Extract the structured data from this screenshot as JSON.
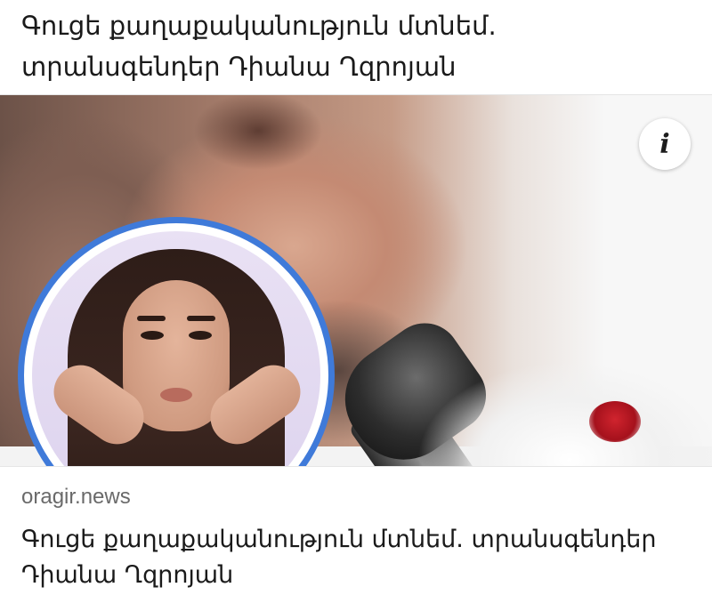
{
  "post": {
    "text": "Գուցե քաղաքականություն մտնեմ. տրանսգենդեր Դիանա Ղզրոյան"
  },
  "link_preview": {
    "info_label": "i",
    "source": "oragir.news",
    "title": "Գուցե քաղաքականություն մտնեմ. տրանսգենդեր Դիանա Ղզրոյան"
  },
  "colors": {
    "avatar_ring": "#3f7ad9",
    "blood": "#c1202a"
  },
  "icons": {
    "info": "info-icon"
  }
}
